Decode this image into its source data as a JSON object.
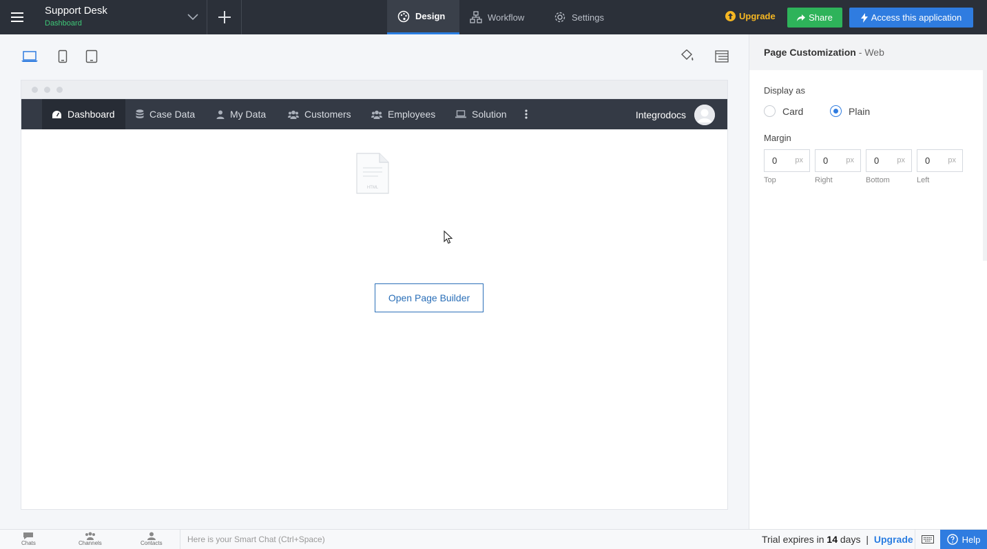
{
  "topbar": {
    "app_title": "Support Desk",
    "app_subtitle": "Dashboard",
    "tabs": [
      {
        "label": "Design",
        "icon": "palette-icon",
        "active": true
      },
      {
        "label": "Workflow",
        "icon": "workflow-icon",
        "active": false
      },
      {
        "label": "Settings",
        "icon": "gear-icon",
        "active": false
      }
    ],
    "upgrade_label": "Upgrade",
    "share_label": "Share",
    "access_label": "Access this application"
  },
  "app_nav": {
    "items": [
      {
        "label": "Dashboard",
        "icon": "dashboard-icon",
        "active": true
      },
      {
        "label": "Case Data",
        "icon": "database-icon",
        "active": false
      },
      {
        "label": "My Data",
        "icon": "user-icon",
        "active": false
      },
      {
        "label": "Customers",
        "icon": "users-icon",
        "active": false
      },
      {
        "label": "Employees",
        "icon": "users-icon",
        "active": false
      },
      {
        "label": "Solution",
        "icon": "laptop-icon",
        "active": false
      }
    ],
    "user_name": "Integrodocs"
  },
  "canvas": {
    "file_caption": "HTML",
    "open_builder_label": "Open Page Builder"
  },
  "panel": {
    "title": "Page Customization",
    "title_suffix": "- Web",
    "display_as_label": "Display as",
    "display_options": [
      {
        "label": "Card",
        "selected": false
      },
      {
        "label": "Plain",
        "selected": true
      }
    ],
    "margin_label": "Margin",
    "margins": [
      {
        "value": "0",
        "unit": "px",
        "label": "Top"
      },
      {
        "value": "0",
        "unit": "px",
        "label": "Right"
      },
      {
        "value": "0",
        "unit": "px",
        "label": "Bottom"
      },
      {
        "value": "0",
        "unit": "px",
        "label": "Left"
      }
    ]
  },
  "bottombar": {
    "items": [
      {
        "label": "Chats"
      },
      {
        "label": "Channels"
      },
      {
        "label": "Contacts"
      }
    ],
    "smart_chat_placeholder": "Here is your Smart Chat (Ctrl+Space)",
    "trial_prefix": "Trial expires in",
    "trial_days": "14",
    "trial_suffix": "days",
    "trial_sep": "|",
    "trial_upgrade": "Upgrade",
    "help_label": "Help"
  },
  "colors": {
    "topbar_bg": "#2b3039",
    "accent_blue": "#2f7ce0",
    "share_green": "#2eb35a",
    "subtitle_green": "#3ec877",
    "upgrade_yellow": "#f5b622"
  }
}
